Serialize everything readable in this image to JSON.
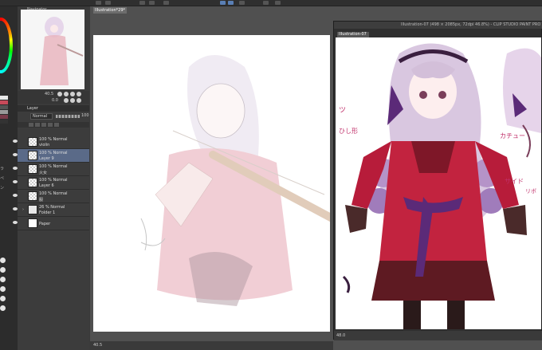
{
  "colors": {
    "accent": "#5a7fb5",
    "selected_layer": "#5a6a88",
    "panel_bg": "#3c3c3c",
    "canvas_bg": "#505050",
    "dress_red": "#c2233f",
    "hair_lilac": "#cdb7d8",
    "ribbon_purple": "#5b2a78"
  },
  "navigator": {
    "title": "Navigator"
  },
  "slider_row": {
    "size_value": "40.5",
    "angle_value": "0.0"
  },
  "layer_panel": {
    "tab_label": "Layer",
    "blend_mode": "Normal",
    "opacity_value": "100",
    "layers": [
      {
        "opacity": "100 % Normal",
        "name": "violin",
        "selected": false,
        "thumb": "checker",
        "visible": true
      },
      {
        "opacity": "100 % Normal",
        "name": "Layer 9",
        "selected": true,
        "thumb": "checker",
        "visible": true
      },
      {
        "opacity": "100 % Normal",
        "name": "火女",
        "selected": false,
        "thumb": "checker",
        "visible": true
      },
      {
        "opacity": "100 % Normal",
        "name": "Layer 6",
        "selected": false,
        "thumb": "checker",
        "visible": true
      },
      {
        "opacity": "100 % Normal",
        "name": "服",
        "selected": false,
        "thumb": "checker",
        "visible": true
      },
      {
        "opacity": "26 % Normal",
        "name": "Folder 1",
        "selected": false,
        "thumb": "folder",
        "visible": true
      },
      {
        "opacity": "",
        "name": "Paper",
        "selected": false,
        "thumb": "white",
        "visible": true
      }
    ]
  },
  "canvas": {
    "tab_label": "Illustration*29*"
  },
  "reference_window": {
    "title": "Illustration-07 (498 × 2085px, 72dpi 46.8%) - CLIP STUDIO PAINT PRO",
    "tab_label": "Illustration-07",
    "status_zoom": "48.0",
    "annotations": [
      "ツ",
      "ひし形",
      "カチュー",
      "サイド",
      "リボ"
    ]
  },
  "statusbar": {
    "zoom": "40.5"
  }
}
